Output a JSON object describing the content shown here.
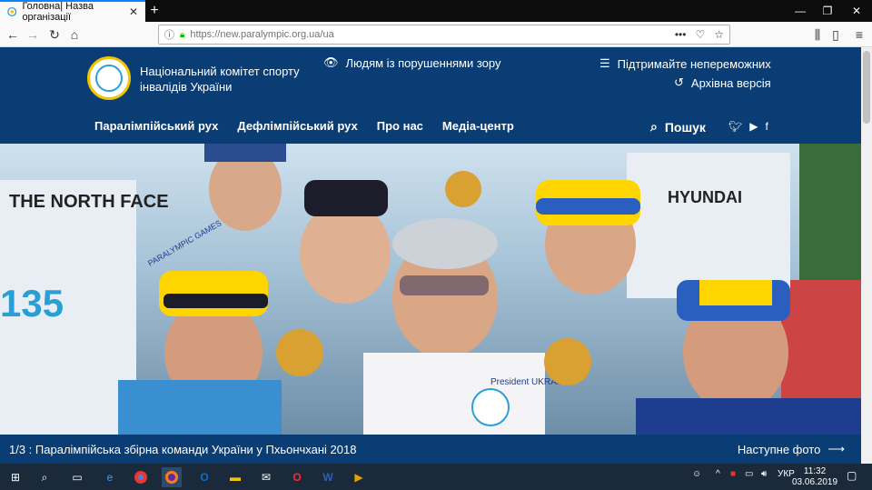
{
  "browser": {
    "tab_title": "Головна| Назва організації",
    "tab_close": "✕",
    "new_tab": "+",
    "url": "https://new.paralympic.org.ua/ua",
    "url_actions": "•••"
  },
  "site": {
    "org_name": "Національний комітет спорту інвалідів України",
    "vision_link": "Людям із порушеннями зору",
    "support_link": "Підтримайте непереможних",
    "archive_link": "Архівна версія",
    "menu": [
      "Паралімпійський рух",
      "Дефлімпійський рух",
      "Про нас",
      "Медіа-центр"
    ],
    "search_label": "Пошук"
  },
  "hero": {
    "caption": "1/3 : Паралімпійська збірна команди України у Пхьончхані 2018",
    "next_label": "Наступне фото",
    "texts": [
      "THE NORTH FACE",
      "HYUNDAI",
      "135",
      "President UKRAINE",
      "PARALYMPIC GAMES",
      "UKRAINE"
    ]
  },
  "taskbar": {
    "lang": "УКР",
    "time": "11:32",
    "date": "03.06.2019"
  },
  "colors": {
    "site_bg": "#0a3d74",
    "tab_accent": "#0a84ff",
    "taskbar_bg": "#1b2a3a"
  }
}
